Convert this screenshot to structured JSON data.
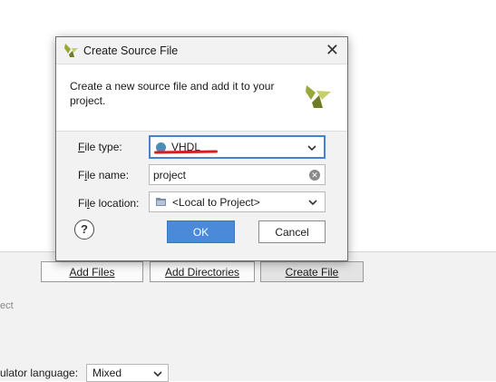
{
  "background": {
    "buttons": [
      {
        "label": "Add Files"
      },
      {
        "label": "Add Directories"
      },
      {
        "label": "Create File"
      }
    ],
    "partial_text": "ect",
    "language_label": "ulator language:",
    "language_value": "Mixed"
  },
  "dialog": {
    "title": "Create Source File",
    "description": "Create a new source file and add it to your project.",
    "fields": {
      "file_type": {
        "label_pre": "F",
        "label_rest": "ile type:",
        "value": "VHDL"
      },
      "file_name": {
        "label_pre": "F",
        "label_u": "i",
        "label_rest": "le name:",
        "value": "project"
      },
      "file_location": {
        "label_pre": "Fi",
        "label_u": "l",
        "label_rest": "e location:",
        "value": "<Local to Project>"
      }
    },
    "help_label": "?",
    "ok_label": "OK",
    "cancel_label": "Cancel"
  },
  "colors": {
    "accent": "#4a8ad8",
    "annotation": "#d42020",
    "vhdl_dot": "#4a8db6",
    "logo_green": "#9aa83a"
  }
}
